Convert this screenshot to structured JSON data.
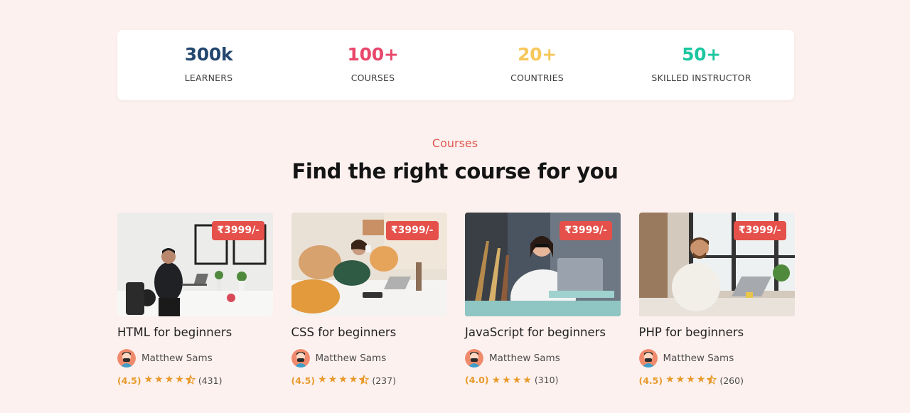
{
  "stats": [
    {
      "value": "300k",
      "label": "LEARNERS",
      "color": "#24476f"
    },
    {
      "value": "100+",
      "label": "COURSES",
      "color": "#e8476a"
    },
    {
      "value": "20+",
      "label": "COUNTRIES",
      "color": "#f7c75a"
    },
    {
      "value": "50+",
      "label": "SKILLED INSTRUCTOR",
      "color": "#1bc6a0"
    }
  ],
  "section": {
    "eyebrow": "Courses",
    "title": "Find the right course for you"
  },
  "courses": [
    {
      "title": "HTML for beginners",
      "price": "₹3999/-",
      "author": "Matthew Sams",
      "rating": "(4.5)",
      "stars": 4.5,
      "count": "(431)"
    },
    {
      "title": "CSS for beginners",
      "price": "₹3999/-",
      "author": "Matthew Sams",
      "rating": "(4.5)",
      "stars": 4.5,
      "count": "(237)"
    },
    {
      "title": "JavaScript for beginners",
      "price": "₹3999/-",
      "author": "Matthew Sams",
      "rating": "(4.0)",
      "stars": 4,
      "count": "(310)"
    },
    {
      "title": "PHP for beginners",
      "price": "₹3999/-",
      "author": "Matthew Sams",
      "rating": "(4.5)",
      "stars": 4.5,
      "count": "(260)"
    }
  ],
  "colors": {
    "accent": "#e5504a",
    "star": "#e89a2b",
    "background": "#fdf1ef"
  },
  "icons": {
    "star": "star-icon",
    "half_star": "star-half-icon",
    "avatar": "user-avatar-icon"
  }
}
